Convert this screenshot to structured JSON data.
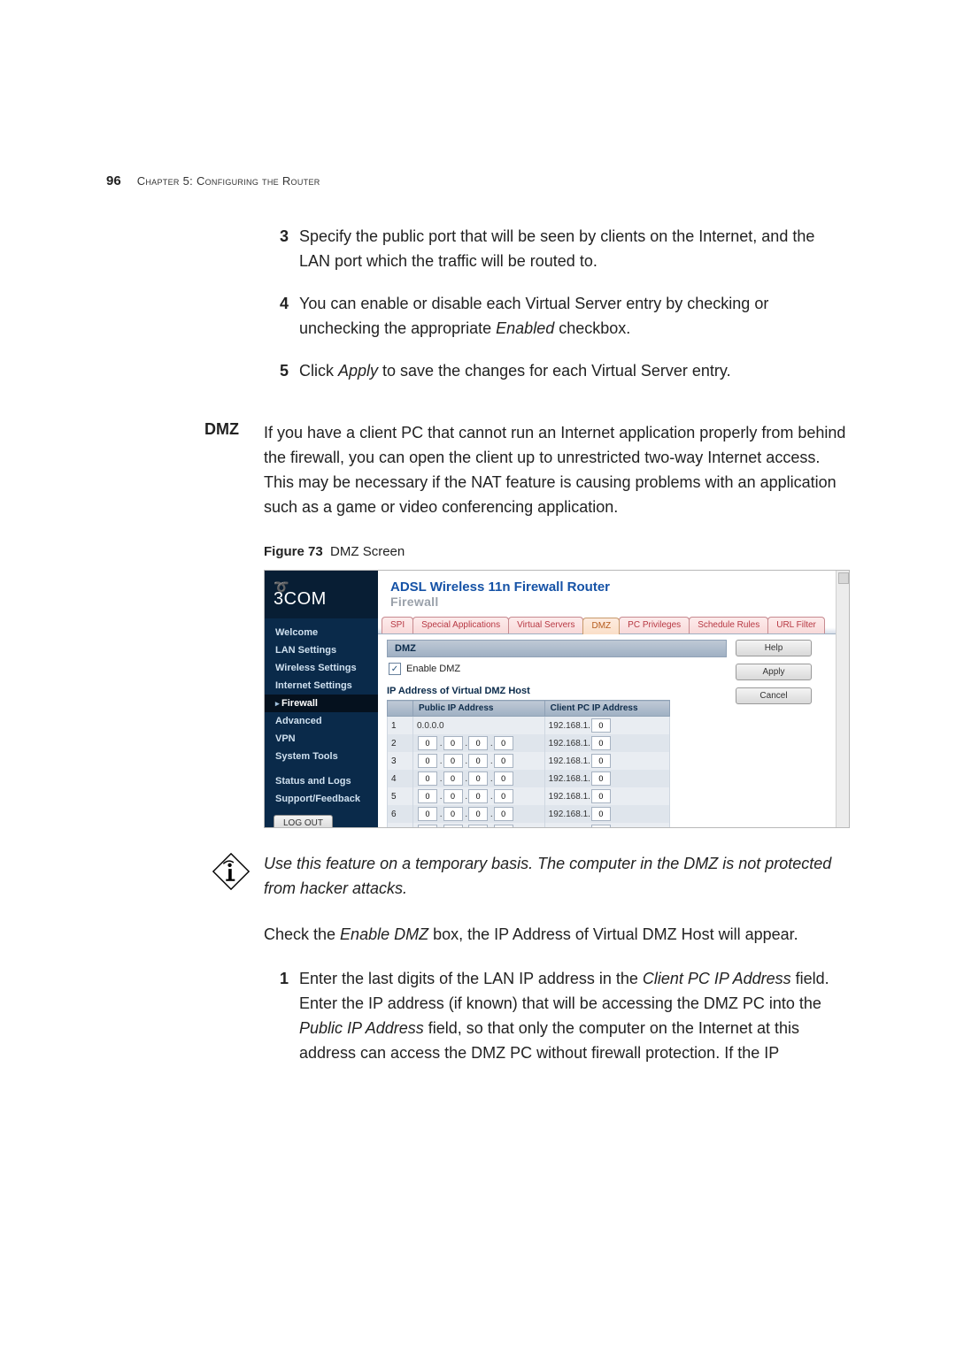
{
  "runhead": {
    "page": "96",
    "chapter": "Chapter 5: Configuring the Router"
  },
  "steps_a": [
    {
      "n": "3",
      "t": "Specify the public port that will be seen by clients on the Internet, and the LAN port which the traffic will be routed to."
    },
    {
      "n": "4",
      "t_pre": "You can enable or disable each Virtual Server entry by checking or unchecking the appropriate ",
      "t_em": "Enabled",
      "t_post": " checkbox."
    },
    {
      "n": "5",
      "t_pre": "Click ",
      "t_em": "Apply",
      "t_post": " to save the changes for each Virtual Server entry."
    }
  ],
  "sect": {
    "head": "DMZ",
    "para": "If you have a client PC that cannot run an Internet application properly from behind the firewall, you can open the client up to unrestricted two-way Internet access. This may be necessary if the NAT feature is causing problems with an application such as a game or video conferencing application."
  },
  "fig": {
    "label": "Figure 73",
    "caption": "DMZ Screen"
  },
  "shot": {
    "brand": "3COM",
    "title": "ADSL Wireless 11n Firewall Router",
    "subtitle": "Firewall",
    "tabs": [
      "SPI",
      "Special Applications",
      "Virtual Servers",
      "DMZ",
      "PC Privileges",
      "Schedule Rules",
      "URL Filter"
    ],
    "active_tab_index": 3,
    "nav": [
      "Welcome",
      "LAN Settings",
      "Wireless Settings",
      "Internet Settings",
      "Firewall",
      "Advanced",
      "VPN",
      "System Tools",
      "",
      "Status and Logs",
      "Support/Feedback"
    ],
    "nav_sel_index": 4,
    "logout": "LOG OUT",
    "panel_title": "DMZ",
    "enable_label": "Enable DMZ",
    "enable_checked": true,
    "table_title": "IP Address of Virtual DMZ Host",
    "col_public": "Public IP Address",
    "col_client": "Client PC IP Address",
    "row1_public": "0.0.0.0",
    "client_prefix": "192.168.1.",
    "octet_default": "0",
    "buttons": {
      "help": "Help",
      "apply": "Apply",
      "cancel": "Cancel"
    }
  },
  "note": "Use this feature on a temporary basis. The computer in the DMZ is not protected from hacker attacks.",
  "after_note_pre": "Check the ",
  "after_note_em": "Enable DMZ",
  "after_note_post": " box, the IP Address of Virtual DMZ Host will appear.",
  "steps_b": [
    {
      "n": "1",
      "segs": [
        {
          "t": "Enter the last digits of the LAN IP address in the "
        },
        {
          "em": "Client PC IP Address"
        },
        {
          "t": " field. Enter the IP address (if known) that will be accessing the DMZ PC into the "
        },
        {
          "em": "Public IP Address"
        },
        {
          "t": " field, so that only the computer on the Internet at this address can access the DMZ PC without firewall protection. If the IP"
        }
      ]
    }
  ]
}
